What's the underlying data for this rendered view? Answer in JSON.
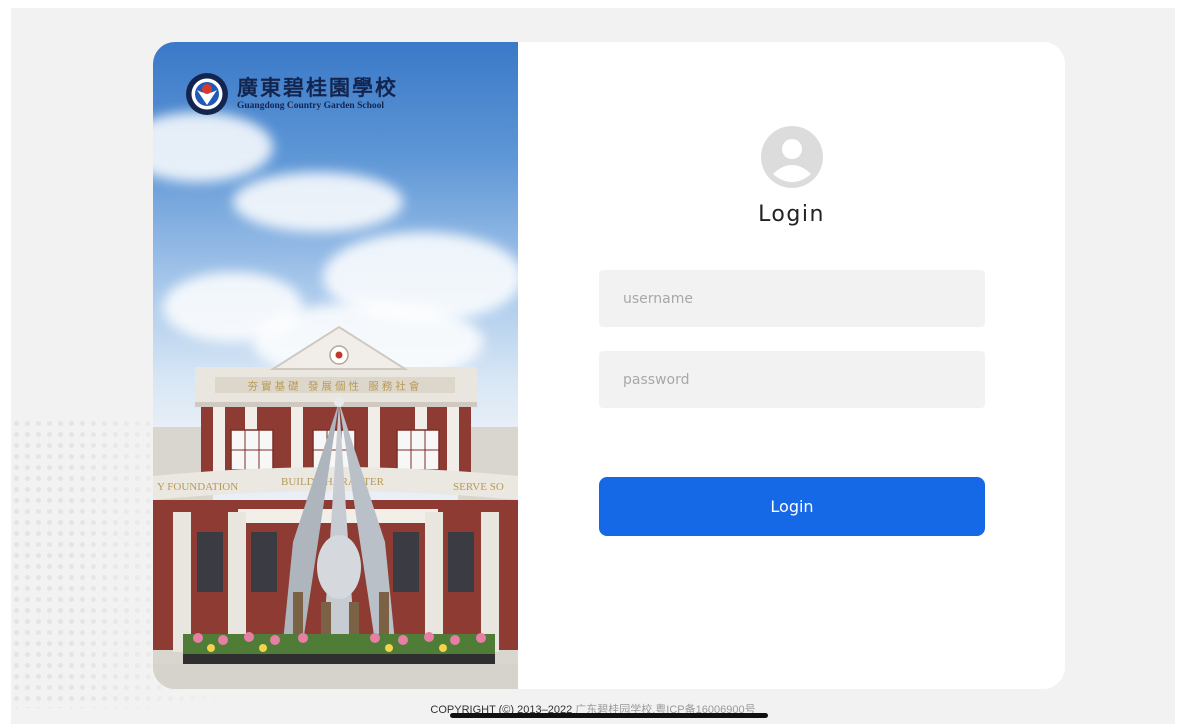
{
  "brand": {
    "school_name_cn": "廣東碧桂園學校",
    "school_name_en": "Guangdong Country Garden School"
  },
  "building_signs": {
    "slogan_cn": "夯實基礎 發展個性 服務社會",
    "foundation": "Y FOUNDATION",
    "build_character": "BUILD CHARACTER",
    "serve": "SERVE SO"
  },
  "login": {
    "title": "Login",
    "username_placeholder": "username",
    "password_placeholder": "password",
    "button_label": "Login"
  },
  "footer": {
    "copyright": "COPYRIGHT (©) 2013–2022",
    "school_icp": "广东碧桂园学校.粤ICP备16006900号"
  },
  "colors": {
    "accent": "#1568e6",
    "logo_navy": "#13254f",
    "field_bg": "#f2f2f2"
  }
}
